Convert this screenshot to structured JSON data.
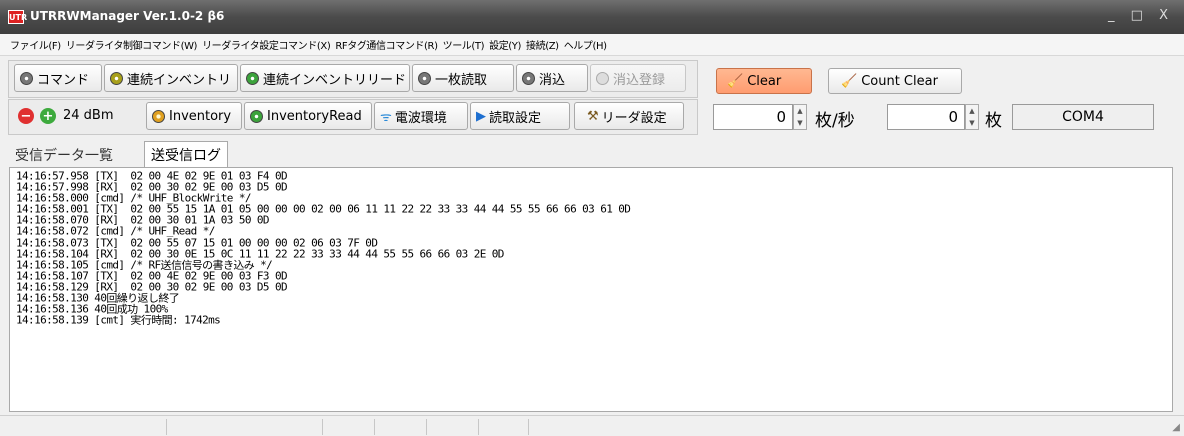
{
  "window": {
    "app_icon": "UTR",
    "title": "UTRRWManager Ver.1.0-2 β6",
    "controls": "_ □ X"
  },
  "menu": [
    "ファイル(F)",
    "リーダライタ制御コマンド(W)",
    "リーダライタ設定コマンド(X)",
    "RFタグ通信コマンド(R)",
    "ツール(T)",
    "設定(Y)",
    "接続(Z)",
    "ヘルプ(H)"
  ],
  "toolbar1": {
    "command": "コマンド",
    "continuous_inventory": "連続インベントリ",
    "continuous_inventory_read": "連続インベントリリード",
    "single_read": "一枚読取",
    "erase": "消込",
    "erase_register": "消込登録"
  },
  "toolbar2": {
    "power": "24 dBm",
    "inventory": "Inventory",
    "inventory_read": "InventoryRead",
    "radio_env": "電波環境",
    "read_settings": "読取設定",
    "reader_settings": "リーダ設定"
  },
  "actions": {
    "clear": "Clear",
    "count_clear": "Count Clear"
  },
  "counters": {
    "rate_value": "0",
    "rate_unit": "枚/秒",
    "count_value": "0",
    "count_unit": "枚",
    "port": "COM4"
  },
  "tabs": [
    "受信データ一覧",
    "送受信ログ"
  ],
  "log_lines": [
    "14:16:57.958 [TX]  02 00 4E 02 9E 01 03 F4 0D",
    "14:16:57.998 [RX]  02 00 30 02 9E 00 03 D5 0D",
    "14:16:58.000 [cmd] /* UHF_BlockWrite */",
    "14:16:58.001 [TX]  02 00 55 15 1A 01 05 00 00 00 02 00 06 11 11 22 22 33 33 44 44 55 55 66 66 03 61 0D",
    "14:16:58.070 [RX]  02 00 30 01 1A 03 50 0D",
    "14:16:58.072 [cmd] /* UHF_Read */",
    "14:16:58.073 [TX]  02 00 55 07 15 01 00 00 00 02 06 03 7F 0D",
    "14:16:58.104 [RX]  02 00 30 0E 15 0C 11 11 22 22 33 33 44 44 55 55 66 66 03 2E 0D",
    "14:16:58.105 [cmd] /* RF送信信号の書き込み */",
    "14:16:58.107 [TX]  02 00 4E 02 9E 00 03 F3 0D",
    "14:16:58.129 [RX]  02 00 30 02 9E 00 03 D5 0D",
    "14:16:58.130 40回繰り返し終了",
    "14:16:58.136 40回成功 100%",
    "14:16:58.139 [cmt] 実行時間: 1742ms"
  ]
}
